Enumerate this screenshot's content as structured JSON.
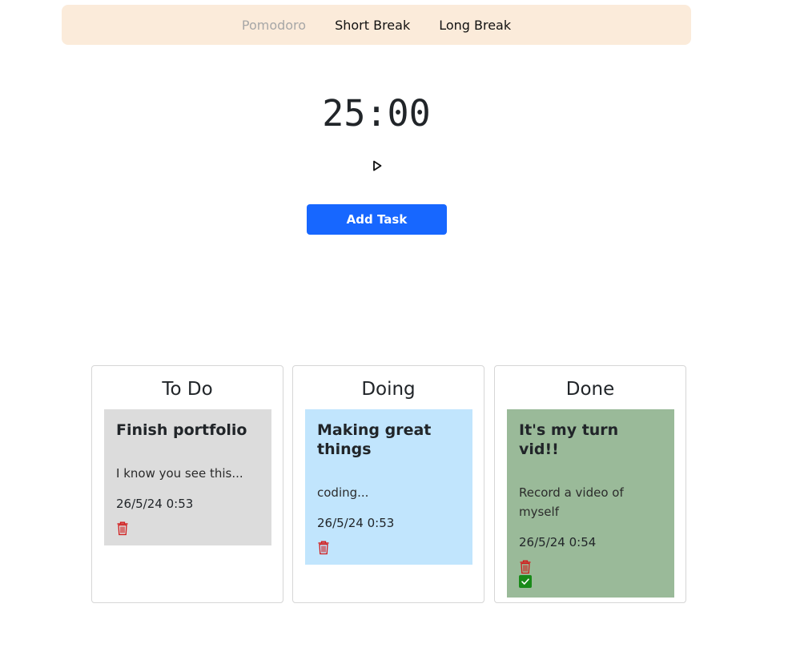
{
  "nav": {
    "items": [
      {
        "label": "Pomodoro",
        "active": true
      },
      {
        "label": "Short Break",
        "active": false
      },
      {
        "label": "Long Break",
        "active": false
      }
    ],
    "background": "#fbebda"
  },
  "timer": {
    "display": "25:00",
    "play_icon": "play-icon"
  },
  "add_task": {
    "label": "Add Task",
    "color": "#1767ff"
  },
  "columns": [
    {
      "title": "To Do",
      "cards": [
        {
          "title": "Finish portfolio",
          "description": "I know you see this...",
          "date": "26/5/24 0:53",
          "color": "#dcdcdc",
          "icons": [
            "trash-icon"
          ]
        }
      ]
    },
    {
      "title": "Doing",
      "cards": [
        {
          "title": "Making great things",
          "description": "coding...",
          "date": "26/5/24 0:53",
          "color": "#c1e5fd",
          "icons": [
            "trash-icon"
          ]
        }
      ]
    },
    {
      "title": "Done",
      "cards": [
        {
          "title": "It's my turn vid!!",
          "description": "Record a video of myself",
          "date": "26/5/24 0:54",
          "color": "#9aba99",
          "icons": [
            "trash-icon",
            "check-icon"
          ]
        }
      ]
    }
  ],
  "colors": {
    "trash": "#d11a1a",
    "check": "#198a19"
  }
}
